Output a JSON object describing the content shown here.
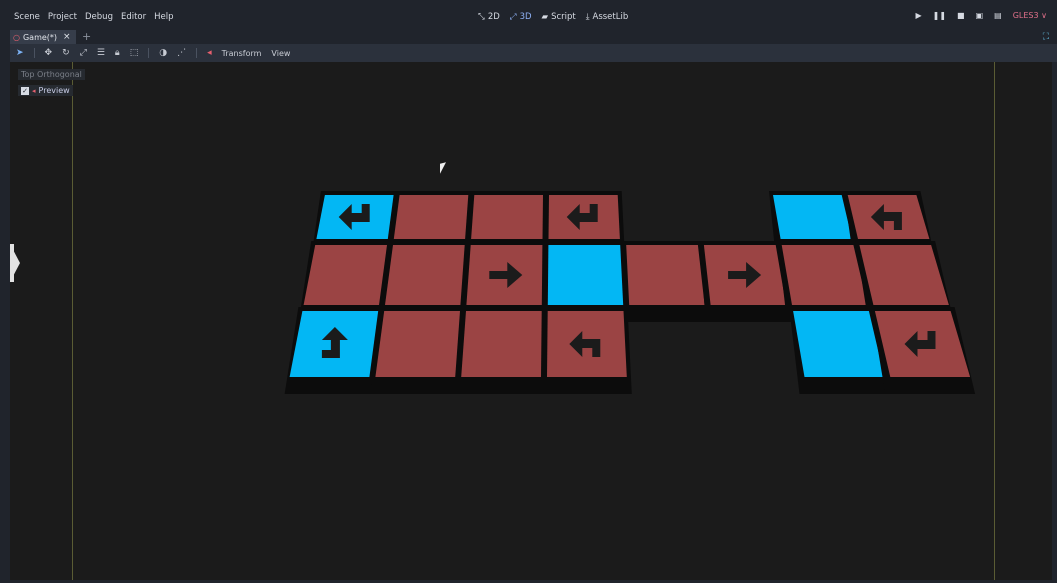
{
  "menubar": {
    "menus": [
      "Scene",
      "Project",
      "Debug",
      "Editor",
      "Help"
    ],
    "workspaces": [
      {
        "label": "2D",
        "icon": "2d-icon",
        "active": false
      },
      {
        "label": "3D",
        "icon": "3d-icon",
        "active": true
      },
      {
        "label": "Script",
        "icon": "script-icon",
        "active": false
      },
      {
        "label": "AssetLib",
        "icon": "assetlib-icon",
        "active": false
      }
    ],
    "renderer": "GLES3"
  },
  "scene_tab": {
    "label": "Game(*)"
  },
  "toolbar": {
    "menus": [
      "Transform",
      "View"
    ]
  },
  "viewport": {
    "view_label": "Top Orthogonal",
    "preview_label": "Preview"
  },
  "board": {
    "colors": {
      "red": "#9b4444",
      "blue": "#03b7f4",
      "arrow": "#1b1b1b"
    },
    "tiles": [
      {
        "row": 0,
        "col": 1,
        "color": "blue",
        "arrow": "turn-down-left"
      },
      {
        "row": 0,
        "col": 2,
        "color": "red",
        "arrow": ""
      },
      {
        "row": 0,
        "col": 3,
        "color": "red",
        "arrow": ""
      },
      {
        "row": 0,
        "col": 4,
        "color": "red",
        "arrow": "turn-down-left"
      },
      {
        "row": 0,
        "col": 7,
        "color": "blue",
        "arrow": ""
      },
      {
        "row": 0,
        "col": 8,
        "color": "red",
        "arrow": "turn-up-left"
      },
      {
        "row": 1,
        "col": 1,
        "color": "red",
        "arrow": ""
      },
      {
        "row": 1,
        "col": 2,
        "color": "red",
        "arrow": ""
      },
      {
        "row": 1,
        "col": 3,
        "color": "red",
        "arrow": "right"
      },
      {
        "row": 1,
        "col": 4,
        "color": "blue",
        "arrow": ""
      },
      {
        "row": 1,
        "col": 5,
        "color": "red",
        "arrow": ""
      },
      {
        "row": 1,
        "col": 6,
        "color": "red",
        "arrow": "right"
      },
      {
        "row": 1,
        "col": 7,
        "color": "red",
        "arrow": ""
      },
      {
        "row": 1,
        "col": 8,
        "color": "red",
        "arrow": ""
      },
      {
        "row": 2,
        "col": 1,
        "color": "blue",
        "arrow": "turn-up-left"
      },
      {
        "row": 2,
        "col": 2,
        "color": "red",
        "arrow": ""
      },
      {
        "row": 2,
        "col": 3,
        "color": "red",
        "arrow": ""
      },
      {
        "row": 2,
        "col": 4,
        "color": "red",
        "arrow": "turn-up-left"
      },
      {
        "row": 2,
        "col": 7,
        "color": "blue",
        "arrow": ""
      },
      {
        "row": 2,
        "col": 8,
        "color": "red",
        "arrow": "turn-down-left"
      }
    ]
  }
}
